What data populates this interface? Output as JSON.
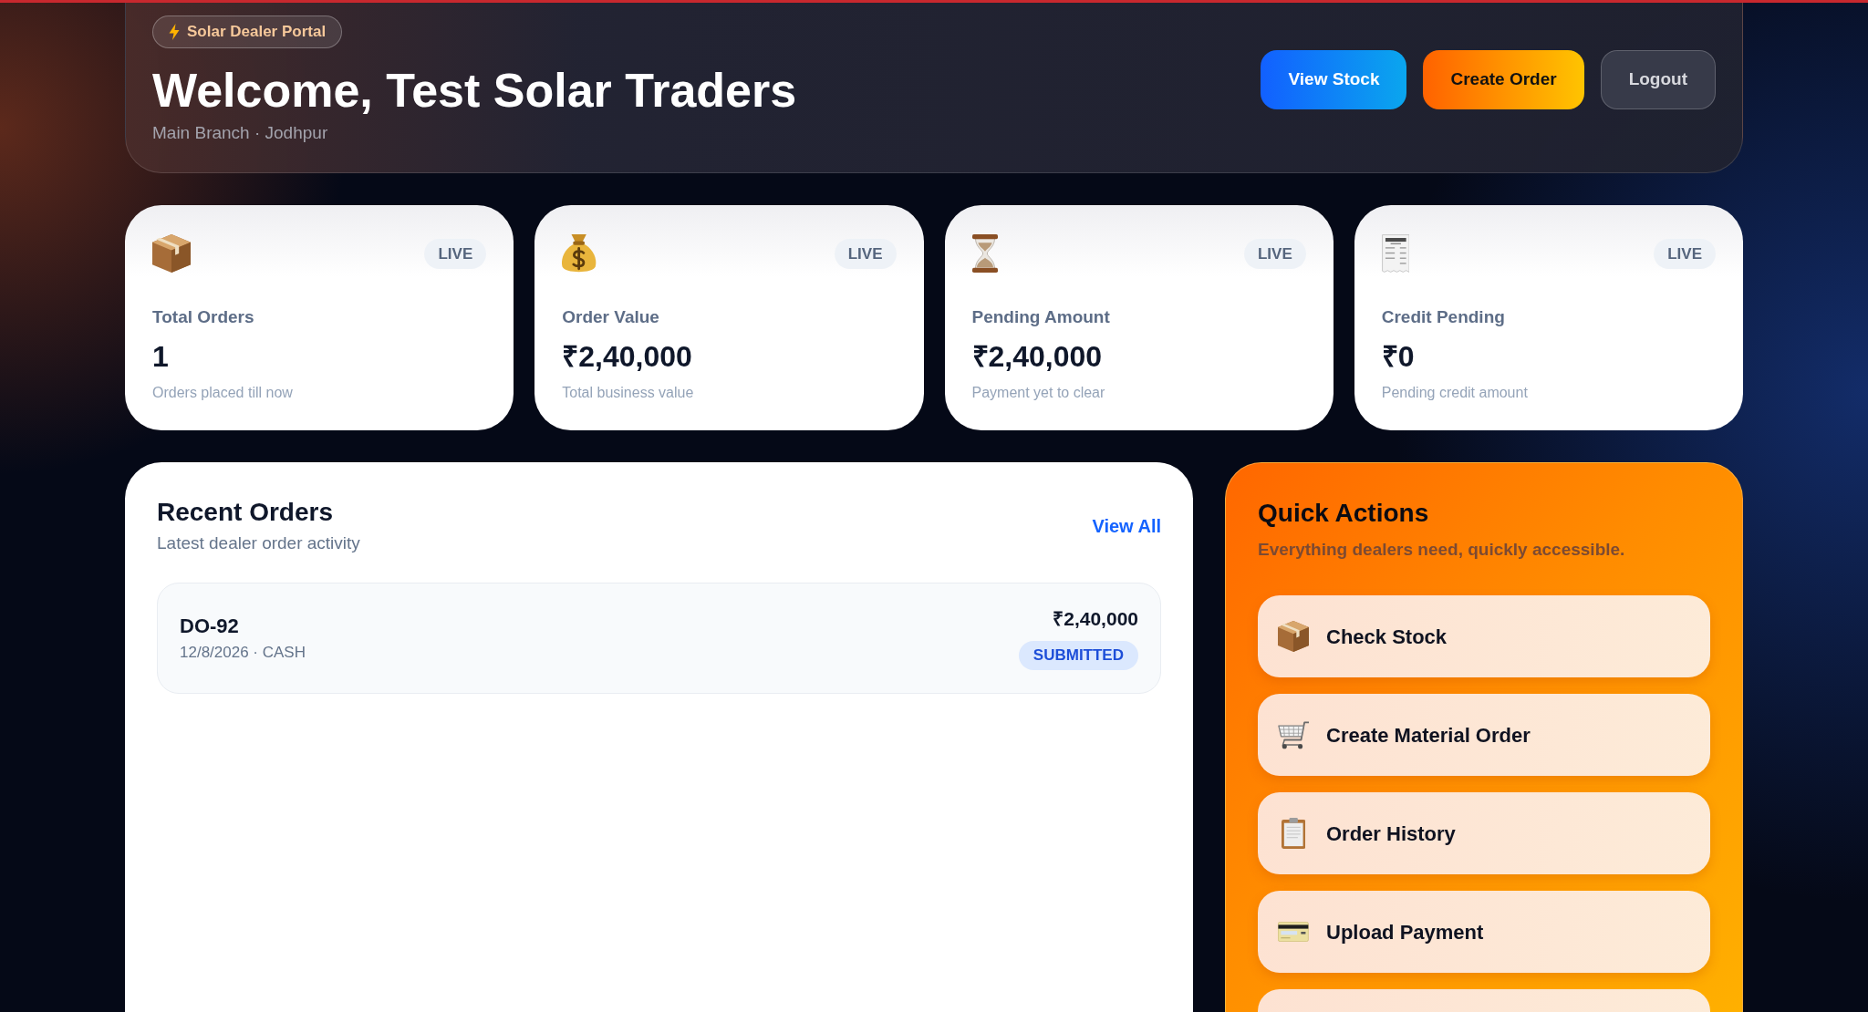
{
  "header": {
    "badge": "Solar Dealer Portal",
    "title": "Welcome, Test Solar Traders",
    "subtitle": "Main Branch · Jodhpur",
    "buttons": [
      {
        "label": "View Stock",
        "kind": "primary"
      },
      {
        "label": "Create Order",
        "kind": "accent"
      },
      {
        "label": "Logout",
        "kind": "ghost"
      }
    ]
  },
  "stats": [
    {
      "tag": "LIVE",
      "label": "Total Orders",
      "value": "1",
      "caption": "Orders placed till now"
    },
    {
      "tag": "LIVE",
      "label": "Order Value",
      "value": "₹2,40,000",
      "caption": "Total business value"
    },
    {
      "tag": "LIVE",
      "label": "Pending Amount",
      "value": "₹2,40,000",
      "caption": "Payment yet to clear"
    },
    {
      "tag": "LIVE",
      "label": "Credit Pending",
      "value": "₹0",
      "caption": "Pending credit amount"
    }
  ],
  "recent_orders": {
    "title": "Recent Orders",
    "subtitle": "Latest dealer order activity",
    "link": "View All",
    "orders": [
      {
        "id": "DO-92",
        "meta": "12/8/2026 · CASH",
        "amount": "₹2,40,000",
        "status": "SUBMITTED"
      }
    ]
  },
  "quick_actions": {
    "title": "Quick Actions",
    "subtitle": "Everything dealers need, quickly accessible.",
    "items": [
      {
        "kind": "action",
        "label": "Check Stock"
      },
      {
        "kind": "action",
        "label": "Create Material Order"
      },
      {
        "kind": "action",
        "label": "Order History"
      },
      {
        "kind": "action",
        "label": "Upload Payment"
      },
      {
        "kind": "cut_off"
      }
    ]
  }
}
